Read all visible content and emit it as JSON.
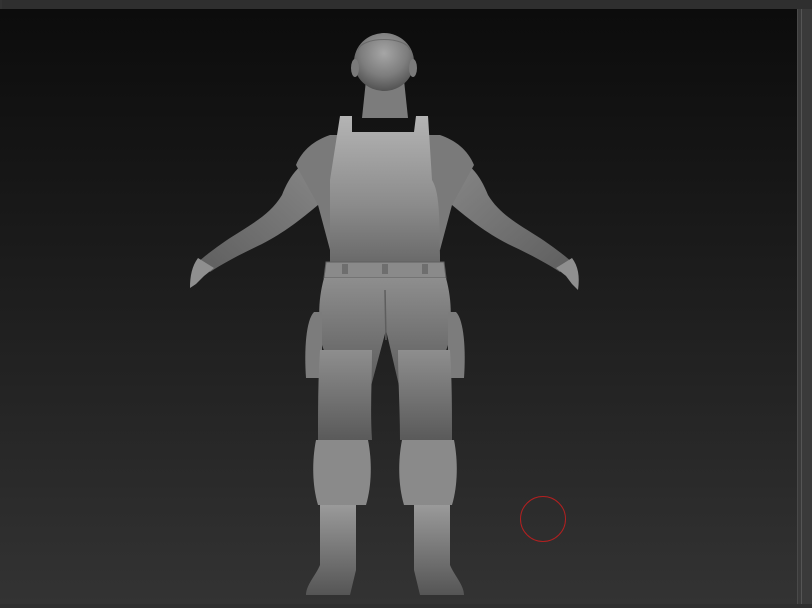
{
  "viewport": {
    "background_top": "#0c0c0c",
    "background_bottom": "#333333",
    "cursor_color": "#b32020",
    "cursor_icon": "brush-draw-size-circle-icon"
  },
  "model": {
    "icon": "sculpted-character-mesh-icon",
    "pose": "t-pose-back-view"
  }
}
